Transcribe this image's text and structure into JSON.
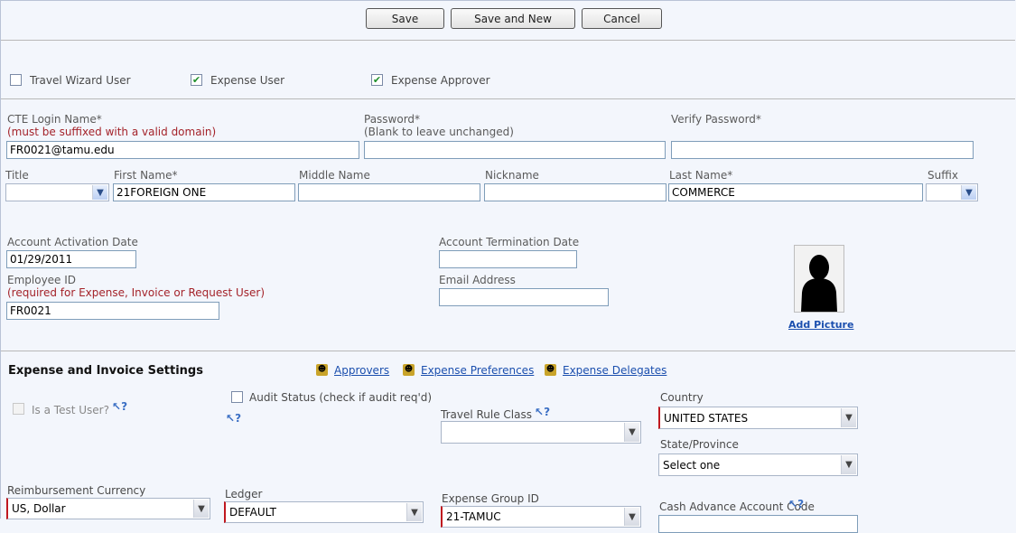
{
  "toolbar": {
    "save": "Save",
    "save_and_new": "Save and New",
    "cancel": "Cancel"
  },
  "roles": {
    "travel_wizard": {
      "label": "Travel Wizard User",
      "checked": false
    },
    "expense_user": {
      "label": "Expense User",
      "checked": true
    },
    "expense_approver": {
      "label": "Expense Approver",
      "checked": true
    }
  },
  "login": {
    "label": "CTE Login Name*",
    "hint": "(must be suffixed with a valid domain)",
    "value": "FR0021@tamu.edu"
  },
  "password": {
    "label": "Password*",
    "hint": "(Blank to leave unchanged)",
    "value": ""
  },
  "verify_password": {
    "label": "Verify Password*",
    "value": ""
  },
  "name": {
    "title_label": "Title",
    "title_value": "",
    "first_label": "First Name*",
    "first_value": "21FOREIGN ONE",
    "middle_label": "Middle Name",
    "middle_value": "",
    "nickname_label": "Nickname",
    "nickname_value": "",
    "last_label": "Last Name*",
    "last_value": "COMMERCE",
    "suffix_label": "Suffix",
    "suffix_value": ""
  },
  "account": {
    "activation_label": "Account Activation Date",
    "activation_value": "01/29/2011",
    "termination_label": "Account Termination Date",
    "termination_value": "",
    "employee_label": "Employee ID",
    "employee_hint": "(required for Expense, Invoice or Request User)",
    "employee_value": "FR0021",
    "email_label": "Email Address",
    "email_value": "",
    "add_picture": "Add Picture"
  },
  "settings": {
    "heading": "Expense and Invoice Settings",
    "links": [
      "Approvers",
      "Expense Preferences",
      "Expense Delegates"
    ],
    "test_user_label": "Is a Test User?",
    "test_user_checked": false,
    "audit_label": "Audit Status (check if audit req'd)",
    "audit_checked": false,
    "help_glyph": "?",
    "travel_rule_label": "Travel Rule Class",
    "travel_rule_value": "",
    "country_label": "Country",
    "country_value": "UNITED STATES",
    "state_label": "State/Province",
    "state_value": "Select one",
    "reimb_label": "Reimbursement Currency",
    "reimb_value": "US, Dollar",
    "ledger_label": "Ledger",
    "ledger_value": "DEFAULT",
    "expense_group_label": "Expense Group ID",
    "expense_group_value": "21-TAMUC",
    "cash_adv_label": "Cash Advance Account Code"
  },
  "icons": {
    "dropdown": "chevron-down-icon",
    "check": "check-icon",
    "help": "help-cursor-icon",
    "nav": "people-link-icon"
  },
  "colors": {
    "required_text": "#a4232a",
    "link": "#1b4fae",
    "required_marker": "#c0181f"
  }
}
